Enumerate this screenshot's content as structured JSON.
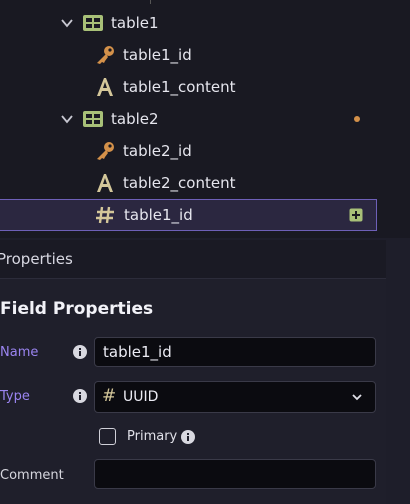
{
  "tree": {
    "items": [
      {
        "label": "table1",
        "kind": "table-icon",
        "expandable": true
      },
      {
        "label": "table1_id",
        "kind": "key-icon"
      },
      {
        "label": "table1_content",
        "kind": "text-type-icon"
      },
      {
        "label": "table2",
        "kind": "table-icon",
        "expandable": true,
        "modified": true
      },
      {
        "label": "table2_id",
        "kind": "key-icon"
      },
      {
        "label": "table2_content",
        "kind": "text-type-icon"
      },
      {
        "label": "table1_id",
        "kind": "hash-icon",
        "selected": true
      }
    ]
  },
  "panel": {
    "header": "Properties",
    "section_title": "Field Properties",
    "name_label": "Name",
    "name_value": "table1_id",
    "type_label": "Type",
    "type_value": "UUID",
    "type_glyph": "#",
    "primary_label": "Primary",
    "primary_checked": false,
    "comment_label": "Comment",
    "comment_value": ""
  },
  "colors": {
    "accent": "#9a84f0",
    "table_icon": "#a8c078",
    "key_icon": "#d4914a",
    "text_icon": "#d4c79a",
    "selection_border": "#6e60b8"
  }
}
